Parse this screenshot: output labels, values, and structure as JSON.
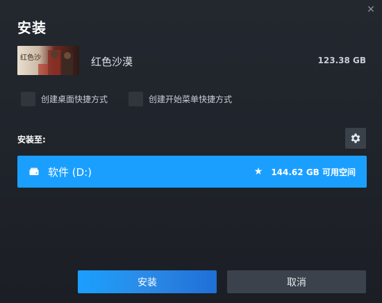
{
  "dialog": {
    "close_glyph": "✕",
    "title": "安装"
  },
  "game": {
    "name": "红色沙漠",
    "size": "123.38 GB",
    "thumbnail_text": "红色沙"
  },
  "options": {
    "desktop_shortcut": {
      "label": "创建桌面快捷方式",
      "checked": false
    },
    "start_menu_shortcut": {
      "label": "创建开始菜单快捷方式",
      "checked": false
    }
  },
  "install_location": {
    "label": "安装至:",
    "settings_icon": "gear-icon",
    "drive": {
      "icon": "drive-icon",
      "name": "软件 (D:)",
      "favorite_icon": "star-icon",
      "free_space": "144.62 GB 可用空间"
    }
  },
  "buttons": {
    "install": "安装",
    "cancel": "取消"
  },
  "colors": {
    "accent": "#1a9fff",
    "background": "#23282f",
    "checkbox": "#31363d",
    "cancel_button": "#3c424b"
  }
}
